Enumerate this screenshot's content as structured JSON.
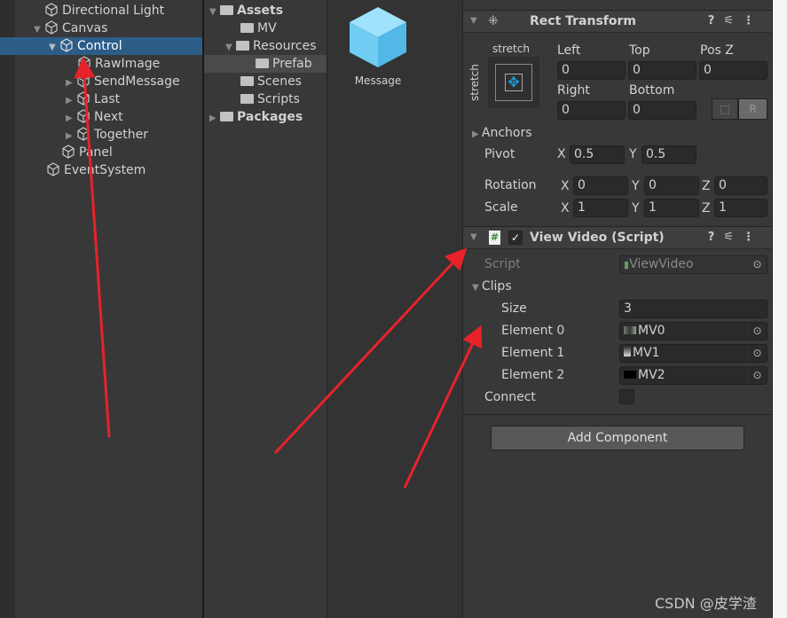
{
  "hierarchy": {
    "items": [
      {
        "label": "Directional Light"
      },
      {
        "label": "Canvas"
      },
      {
        "label": "Control"
      },
      {
        "label": "RawImage"
      },
      {
        "label": "SendMessage"
      },
      {
        "label": "Last"
      },
      {
        "label": "Next"
      },
      {
        "label": "Together"
      },
      {
        "label": "Panel"
      },
      {
        "label": "EventSystem"
      }
    ]
  },
  "project": {
    "tree": [
      {
        "label": "Assets"
      },
      {
        "label": "MV"
      },
      {
        "label": "Resources"
      },
      {
        "label": "Prefab"
      },
      {
        "label": "Scenes"
      },
      {
        "label": "Scripts"
      },
      {
        "label": "Packages"
      }
    ],
    "asset": {
      "label": "Message"
    }
  },
  "inspector": {
    "rect": {
      "title": "Rect Transform",
      "anchor_h": "stretch",
      "anchor_v": "stretch",
      "left_label": "Left",
      "left": "0",
      "top_label": "Top",
      "top": "0",
      "posz_label": "Pos Z",
      "posz": "0",
      "right_label": "Right",
      "right": "0",
      "bottom_label": "Bottom",
      "bottom": "0",
      "anchors": "Anchors",
      "pivot": "Pivot",
      "pivot_x": "0.5",
      "pivot_y": "0.5",
      "rotation": "Rotation",
      "rot_x": "0",
      "rot_y": "0",
      "rot_z": "0",
      "scale": "Scale",
      "scale_x": "1",
      "scale_y": "1",
      "scale_z": "1",
      "x": "X",
      "y": "Y",
      "z": "Z"
    },
    "script": {
      "title": "View Video (Script)",
      "enabled": true,
      "script_label": "Script",
      "script_value": "ViewVideo",
      "clips": "Clips",
      "size_label": "Size",
      "size": "3",
      "elements": [
        {
          "label": "Element 0",
          "value": "MV0"
        },
        {
          "label": "Element 1",
          "value": "MV1"
        },
        {
          "label": "Element 2",
          "value": "MV2"
        }
      ],
      "connect": "Connect"
    },
    "add_component": "Add Component"
  },
  "watermark": "CSDN @皮学渣",
  "colors": {
    "selection": "#2c5d87",
    "arrow": "#e8222a",
    "cube": "#76d0f5"
  }
}
